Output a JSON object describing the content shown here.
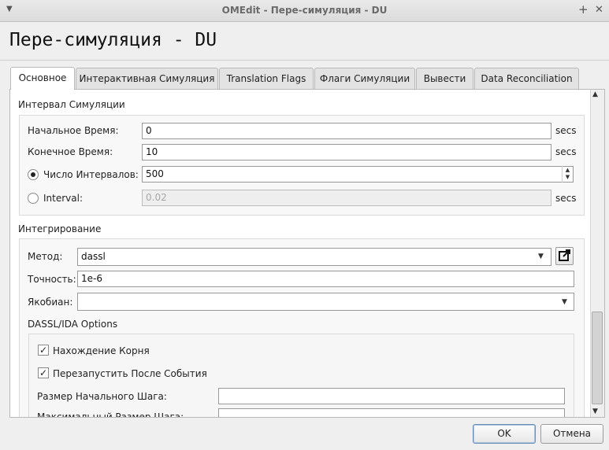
{
  "window": {
    "title": "OMEdit - Пере-симуляция - DU",
    "menu_icon": "chevron-down-icon",
    "maximize_glyph": "+",
    "close_glyph": "✕"
  },
  "heading": "Пере-симуляция - DU",
  "tabs": [
    {
      "label": "Основное",
      "active": true
    },
    {
      "label": "Интерактивная Симуляция"
    },
    {
      "label": "Translation Flags"
    },
    {
      "label": "Флаги Симуляции"
    },
    {
      "label": "Вывести"
    },
    {
      "label": "Data Reconciliation"
    }
  ],
  "simulation_interval": {
    "title": "Интервал Симуляции",
    "start_time": {
      "label": "Начальное Время:",
      "value": "0",
      "unit": "secs"
    },
    "stop_time": {
      "label": "Конечное Время:",
      "value": "10",
      "unit": "secs"
    },
    "number_of_intervals": {
      "label": "Число Интервалов:",
      "value": "500",
      "selected": true
    },
    "interval": {
      "label": "Interval:",
      "value": "0.02",
      "unit": "secs",
      "selected": false
    }
  },
  "integration": {
    "title": "Интегрирование",
    "method": {
      "label": "Метод:",
      "value": "dassl"
    },
    "tolerance": {
      "label": "Точность:",
      "value": "1e-6"
    },
    "jacobian": {
      "label": "Якобиан:",
      "value": ""
    },
    "dassl_options": {
      "title": "DASSL/IDA Options",
      "root_finding": {
        "label": "Нахождение Корня",
        "checked": true
      },
      "restart_after_event": {
        "label": "Перезапустить После События",
        "checked": true
      },
      "initial_step_size": {
        "label": "Размер Начального Шага:",
        "value": ""
      },
      "max_step_size": {
        "label": "Максимальный Размер Шага:",
        "value": ""
      }
    }
  },
  "buttons": {
    "ok": "OK",
    "cancel": "Отмена"
  },
  "colors": {
    "default_button_border": "#6a8fb9",
    "pane_background": "#ffffff"
  }
}
